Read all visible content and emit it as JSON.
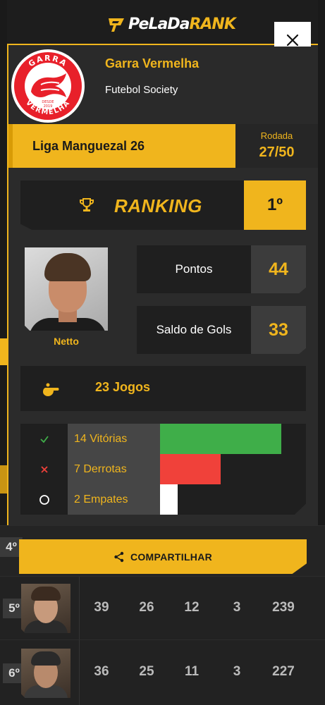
{
  "brand": {
    "logo_part1": "PeLaDa",
    "logo_part2": "RANK"
  },
  "team": {
    "name": "Garra Vermelha",
    "type": "Futebol Society",
    "crest_top": "GARRA",
    "crest_bottom": "VERMELHA",
    "crest_since": "DESDE",
    "crest_year": "2019"
  },
  "league": {
    "name": "Liga Manguezal 26",
    "round_label": "Rodada",
    "round_value": "27/50"
  },
  "ranking": {
    "label": "RANKING",
    "position": "1º"
  },
  "player": {
    "name": "Netto"
  },
  "stats": [
    {
      "label": "Pontos",
      "value": "44"
    },
    {
      "label": "Saldo de Gols",
      "value": "33"
    }
  ],
  "games": {
    "label": "23 Jogos"
  },
  "results": [
    {
      "label": "14 Vitórias",
      "icon": "check-icon",
      "count": 14,
      "color": "#3fae49"
    },
    {
      "label": "7 Derrotas",
      "icon": "x-icon",
      "count": 7,
      "color": "#f0413a"
    },
    {
      "label": "2 Empates",
      "icon": "circle-icon",
      "count": 2,
      "color": "#ffffff"
    }
  ],
  "share": {
    "label": "COMPARTILHAR"
  },
  "background_table": {
    "rows": [
      {
        "rank": "4º",
        "values": []
      },
      {
        "rank": "5º",
        "values": [
          "39",
          "26",
          "12",
          "3",
          "239"
        ]
      },
      {
        "rank": "6º",
        "values": [
          "36",
          "25",
          "11",
          "3",
          "227"
        ]
      }
    ]
  },
  "colors": {
    "accent": "#f0b51d",
    "dark": "#1f1f1f",
    "panel": "#2b2b2b"
  }
}
